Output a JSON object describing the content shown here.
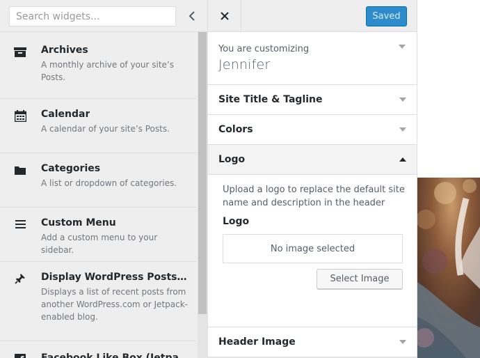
{
  "widgets_panel": {
    "search": {
      "placeholder": "Search widgets..."
    },
    "back_icon": "chevron-left-icon",
    "widgets": [
      {
        "title": "Archives",
        "description": "A monthly archive of your site’s Posts.",
        "icon": "archive-icon"
      },
      {
        "title": "Calendar",
        "description": "A calendar of your site’s Posts.",
        "icon": "calendar-icon"
      },
      {
        "title": "Categories",
        "description": "A list or dropdown of categories.",
        "icon": "folder-icon"
      },
      {
        "title": "Custom Menu",
        "description": "Add a custom menu to your sidebar.",
        "icon": "menu-icon"
      },
      {
        "title": "Display WordPress Posts (Jetpack)",
        "description": "Displays a list of recent posts from another WordPress.com or Jetpack-enabled blog.",
        "icon": "pushpin-icon"
      },
      {
        "title": "Facebook Like Box (Jetpack)",
        "description": "",
        "icon": "facebook-icon"
      }
    ]
  },
  "customizer": {
    "close_icon": "close-icon",
    "save_button": "Saved",
    "info": {
      "label": "You are customizing",
      "site_name": "Jennifer"
    },
    "sections": {
      "site_title": "Site Title & Tagline",
      "colors": "Colors",
      "logo": "Logo",
      "header_image": "Header Image"
    },
    "logo_panel": {
      "description": "Upload a logo to replace the default site name and description in the header",
      "label": "Logo",
      "placeholder": "No image selected",
      "select_button": "Select Image"
    }
  },
  "colors": {
    "accent": "#2e8ccc",
    "panel_bg": "#eeeeee",
    "border": "#dddddd"
  }
}
